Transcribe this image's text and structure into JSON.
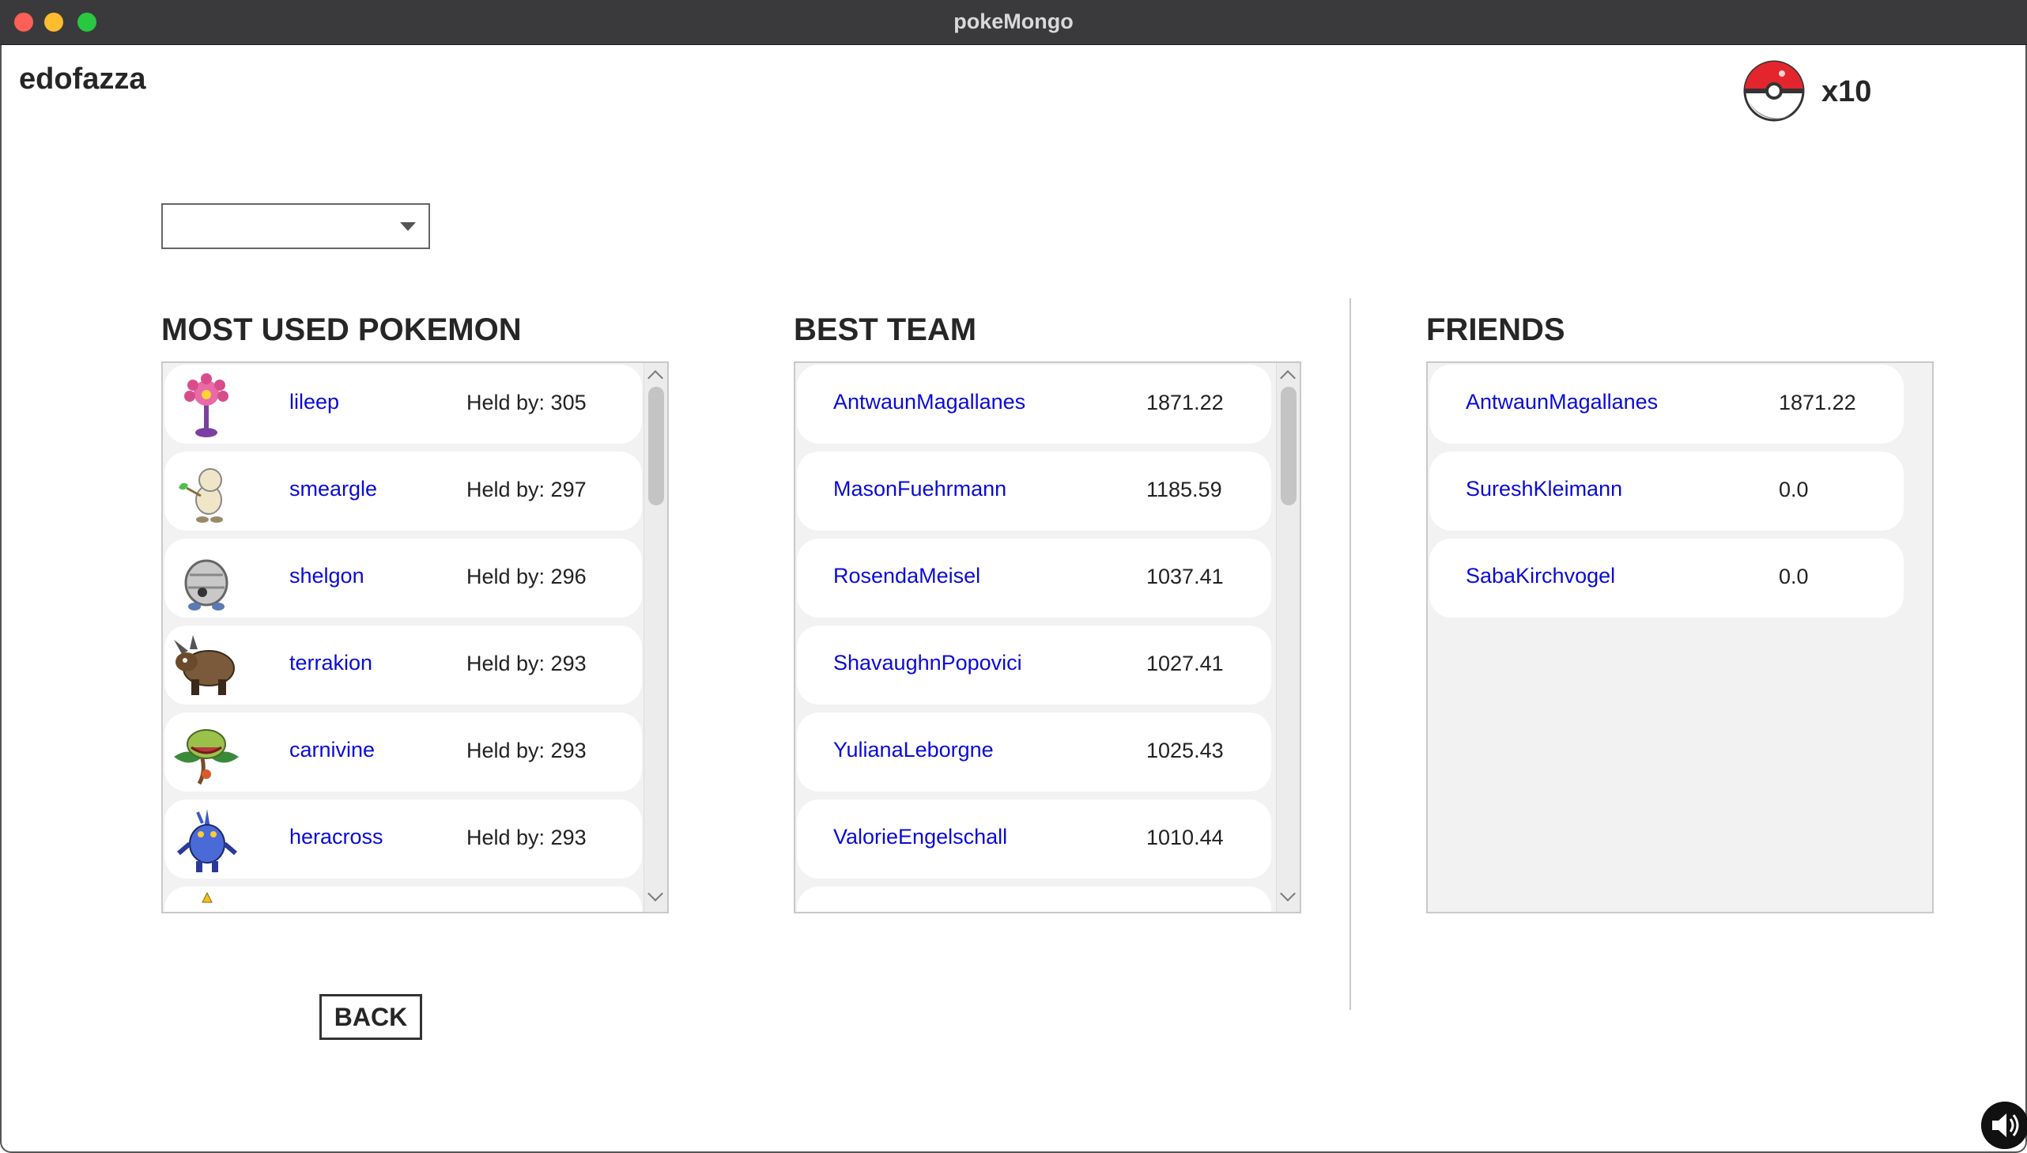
{
  "window": {
    "title": "pokeMongo"
  },
  "header": {
    "username": "edofazza",
    "pokeball_count": "x10"
  },
  "filter": {
    "selected": ""
  },
  "most_used": {
    "title": "MOST USED POKEMON",
    "items": [
      {
        "name": "lileep",
        "held": "Held by: 305"
      },
      {
        "name": "smeargle",
        "held": "Held by: 297"
      },
      {
        "name": "shelgon",
        "held": "Held by: 296"
      },
      {
        "name": "terrakion",
        "held": "Held by: 293"
      },
      {
        "name": "carnivine",
        "held": "Held by: 293"
      },
      {
        "name": "heracross",
        "held": "Held by: 293"
      }
    ]
  },
  "best_team": {
    "title": "BEST TEAM",
    "items": [
      {
        "name": "AntwaunMagallanes",
        "score": "1871.22"
      },
      {
        "name": "MasonFuehrmann",
        "score": "1185.59"
      },
      {
        "name": "RosendaMeisel",
        "score": "1037.41"
      },
      {
        "name": "ShavaughnPopovici",
        "score": "1027.41"
      },
      {
        "name": "YulianaLeborgne",
        "score": "1025.43"
      },
      {
        "name": "ValorieEngelschall",
        "score": "1010.44"
      }
    ]
  },
  "friends": {
    "title": "FRIENDS",
    "items": [
      {
        "name": "AntwaunMagallanes",
        "score": "1871.22"
      },
      {
        "name": "SureshKleimann",
        "score": "0.0"
      },
      {
        "name": "SabaKirchvogel",
        "score": "0.0"
      }
    ]
  },
  "actions": {
    "back_label": "BACK"
  },
  "colors": {
    "link": "#0b0bd6",
    "titlebar": "#3a3a3c",
    "pokeball_red": "#e3262d"
  }
}
